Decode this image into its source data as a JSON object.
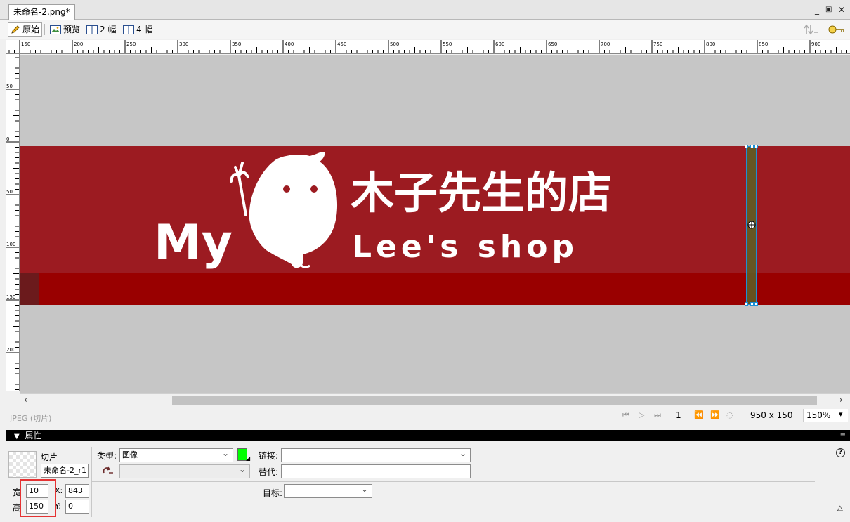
{
  "document_tab": {
    "title": "未命名-2.png*"
  },
  "window_controls": {
    "minimize": "_",
    "restore": "🗗",
    "close": "✕"
  },
  "toolbar": {
    "original_label": "原始",
    "preview_label": "预览",
    "two_up_label": "2 幅",
    "four_up_label": "4 幅"
  },
  "ruler": {
    "horizontal_ticks": [
      "150",
      "200",
      "250",
      "300",
      "350",
      "400",
      "450",
      "500",
      "550",
      "600",
      "650",
      "700",
      "750",
      "800",
      "850",
      "900"
    ],
    "vertical_ticks": [
      "50",
      "0",
      "50",
      "100",
      "150",
      "200"
    ]
  },
  "canvas": {
    "background_color": "#c6c6c6",
    "banner_color": "#9c1b21",
    "banner_bottom_color": "#990000",
    "banner_text_my": "My",
    "banner_text_cn": "木子先生的店",
    "banner_text_en": "Lee's shop"
  },
  "status": {
    "format_text": "JPEG (切片)",
    "frame_number": "1",
    "image_size": "950 x 150",
    "zoom": "150%"
  },
  "properties": {
    "panel_title": "属性",
    "slice_label": "切片",
    "slice_name": "未命名-2_r1",
    "type_label": "类型:",
    "type_value": "图像",
    "swatch_color": "#00ff00",
    "link_label": "链接:",
    "link_value": "",
    "alt_label": "替代:",
    "alt_value": "",
    "target_label": "目标:",
    "target_value": "",
    "width_label": "宽",
    "width_value": "10",
    "height_label": "高",
    "height_value": "150",
    "x_label": "X:",
    "x_value": "843",
    "y_label": "Y:",
    "y_value": "0",
    "help_icon": "?"
  }
}
